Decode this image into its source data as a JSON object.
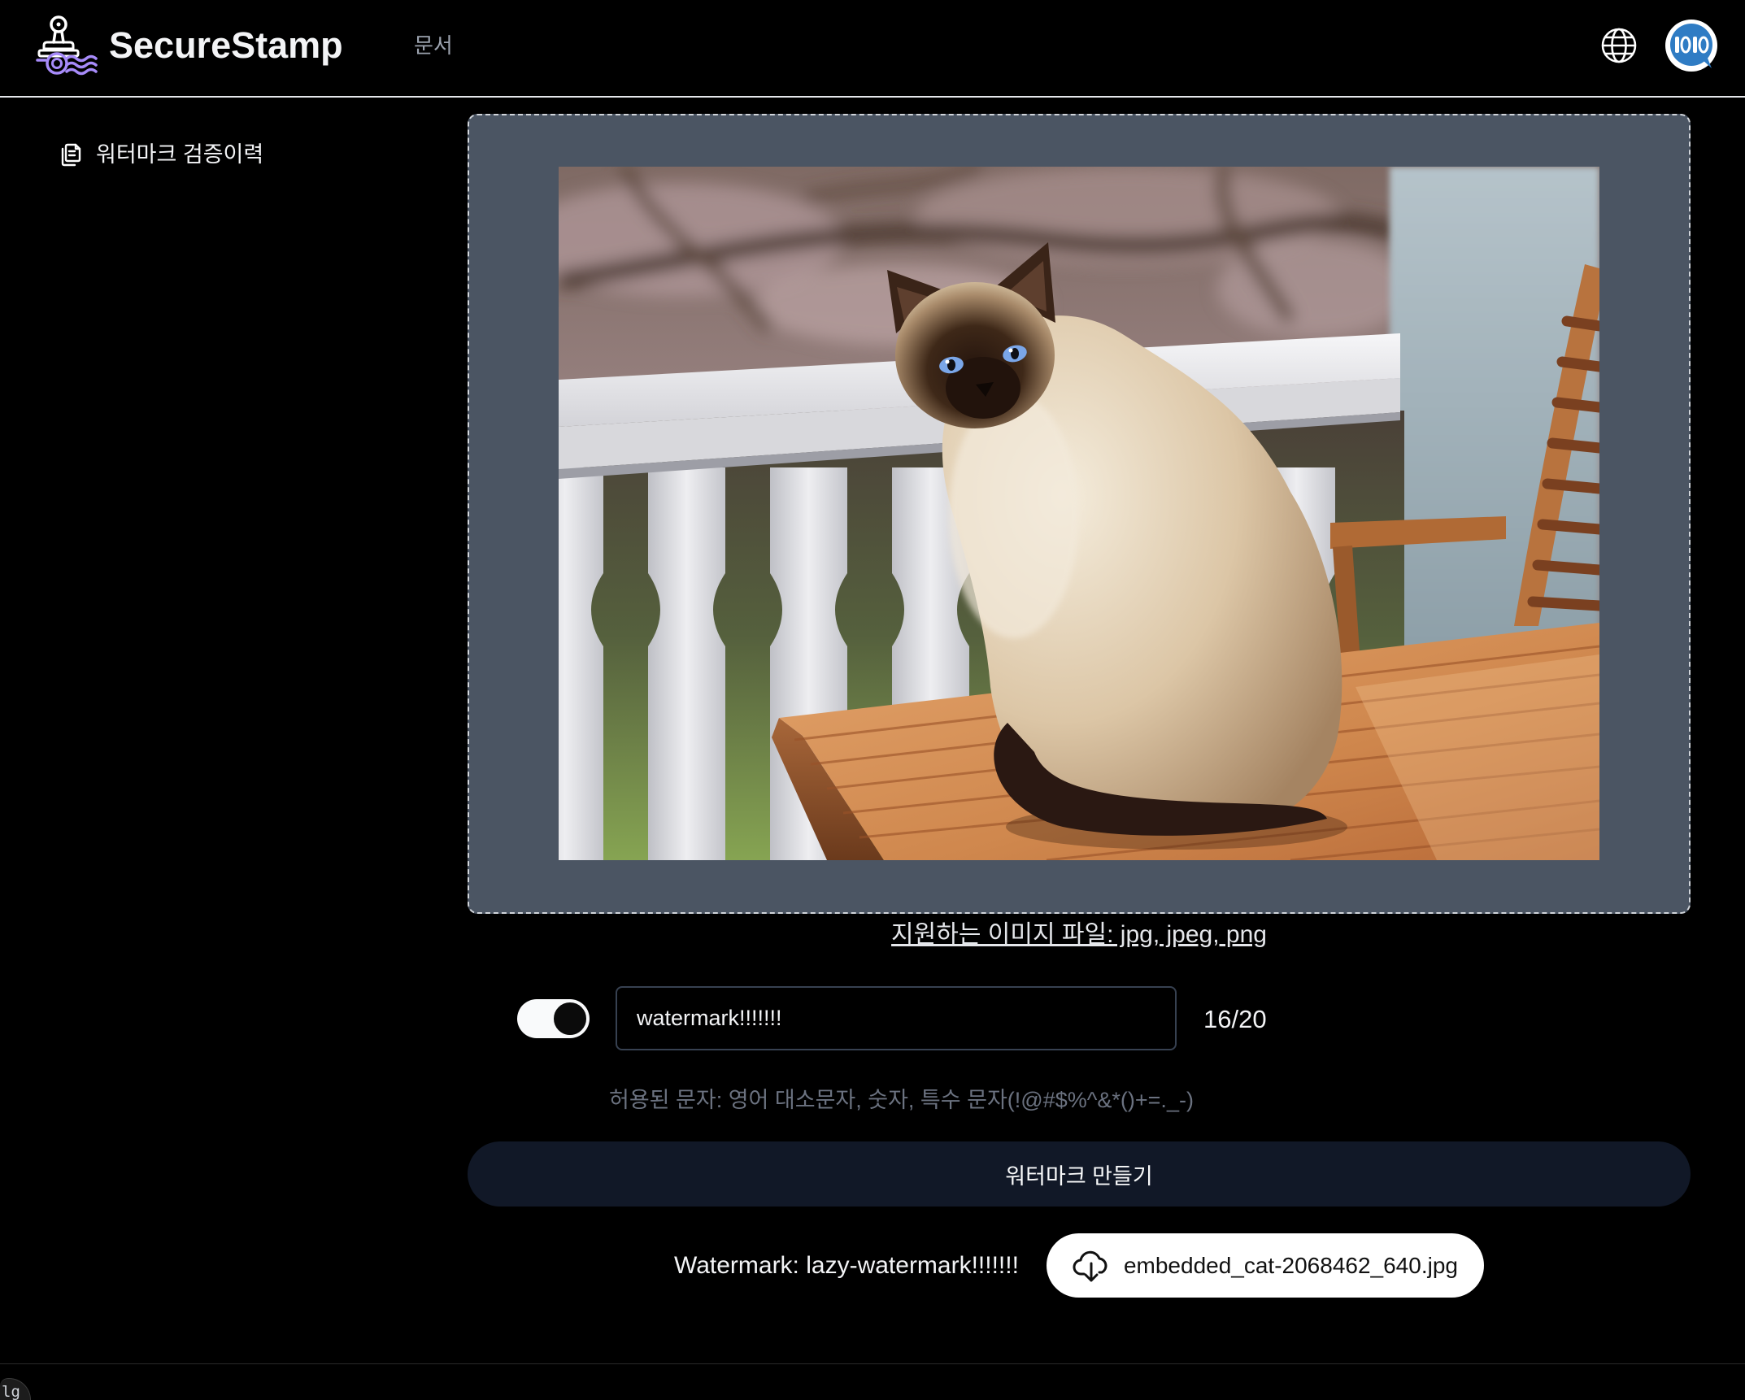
{
  "app": {
    "title": "SecureStamp"
  },
  "nav": {
    "docs": "문서"
  },
  "header": {
    "icons": {
      "logo": "stamp-logo-icon",
      "language": "globe-icon",
      "account": "avatar"
    }
  },
  "sidebar": {
    "items": [
      {
        "label": "워터마크 검증이력",
        "icon": "copy-icon"
      }
    ]
  },
  "upload": {
    "supported_text": "지원하는 이미지 파일: jpg, jpeg, png"
  },
  "watermark": {
    "enabled": true,
    "input_value": "watermark!!!!!!!",
    "counter": "16/20",
    "allowed_hint": "허용된 문자: 영어 대소문자, 숫자, 특수 문자(!@#$%^&*()+=._-)"
  },
  "actions": {
    "create_label": "워터마크 만들기"
  },
  "result": {
    "label": "Watermark: lazy-watermark!!!!!!!",
    "download_filename": "embedded_cat-2068462_640.jpg",
    "download_icon": "cloud-download-icon"
  },
  "dev_indicator": {
    "label": "lg"
  },
  "theme": {
    "background": "#000000",
    "dropzone": "#4b5563",
    "primary_button": "#111827",
    "accent": "#a78bfa"
  }
}
